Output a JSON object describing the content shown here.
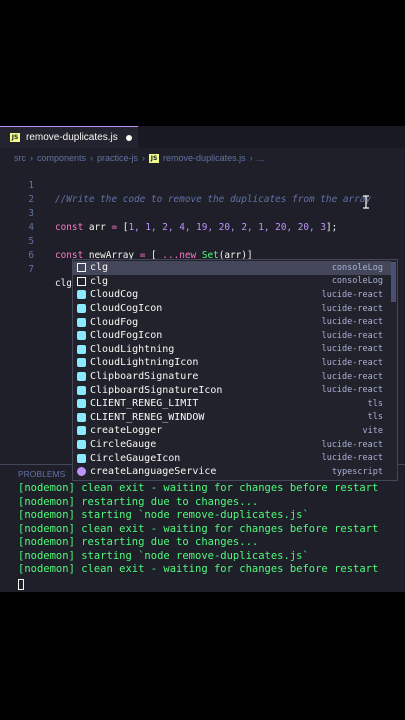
{
  "tab": {
    "filename": "remove-duplicates.js",
    "icon": "JS"
  },
  "breadcrumb": [
    "src",
    "components",
    "practice-js",
    "remove-duplicates.js",
    "..."
  ],
  "lines": [
    {
      "n": "1",
      "comment": "//Write the code to remove the duplicates from the array"
    },
    {
      "n": "2"
    },
    {
      "n": "3",
      "kw": "const",
      "name": " arr ",
      "eq": "=",
      "sp": " ",
      "open": "[",
      "nums": "1, 1, 2, 4, 19, 20, 2, 1, 20, 20, 3",
      "close": "];"
    },
    {
      "n": "4"
    },
    {
      "n": "5",
      "kw": "const",
      "name": " newArray ",
      "eq": "=",
      "sp": " ",
      "open": "[",
      "spread": " ...",
      "new": "new",
      "cls": " Set",
      "arg": "(arr)",
      "close": "]"
    },
    {
      "n": "6"
    },
    {
      "n": "7",
      "typed": "clg"
    }
  ],
  "suggestions": [
    {
      "label": "clg",
      "source": "consoleLog",
      "kind": "text",
      "selected": true
    },
    {
      "label": "clg",
      "source": "consoleLog",
      "kind": "text"
    },
    {
      "label": "CloudCog",
      "source": "lucide-react",
      "kind": "var"
    },
    {
      "label": "CloudCogIcon",
      "source": "lucide-react",
      "kind": "var"
    },
    {
      "label": "CloudFog",
      "source": "lucide-react",
      "kind": "var"
    },
    {
      "label": "CloudFogIcon",
      "source": "lucide-react",
      "kind": "var"
    },
    {
      "label": "CloudLightning",
      "source": "lucide-react",
      "kind": "var"
    },
    {
      "label": "CloudLightningIcon",
      "source": "lucide-react",
      "kind": "var"
    },
    {
      "label": "ClipboardSignature",
      "source": "lucide-react",
      "kind": "var"
    },
    {
      "label": "ClipboardSignatureIcon",
      "source": "lucide-react",
      "kind": "var"
    },
    {
      "label": "CLIENT_RENEG_LIMIT",
      "source": "tls",
      "kind": "var"
    },
    {
      "label": "CLIENT_RENEG_WINDOW",
      "source": "tls",
      "kind": "var"
    },
    {
      "label": "createLogger",
      "source": "vite",
      "kind": "var"
    },
    {
      "label": "CircleGauge",
      "source": "lucide-react",
      "kind": "var"
    },
    {
      "label": "CircleGaugeIcon",
      "source": "lucide-react",
      "kind": "var"
    },
    {
      "label": "createLanguageService",
      "source": "typescript",
      "kind": "fnc"
    }
  ],
  "panel": {
    "tab": "PROBLEMS"
  },
  "terminal": [
    "[nodemon] clean exit - waiting for changes before restart",
    "[nodemon] restarting due to changes...",
    "[nodemon] starting `node remove-duplicates.js`",
    "[nodemon] clean exit - waiting for changes before restart",
    "[nodemon] restarting due to changes...",
    "[nodemon] starting `node remove-duplicates.js`",
    "[nodemon] clean exit - waiting for changes before restart"
  ]
}
